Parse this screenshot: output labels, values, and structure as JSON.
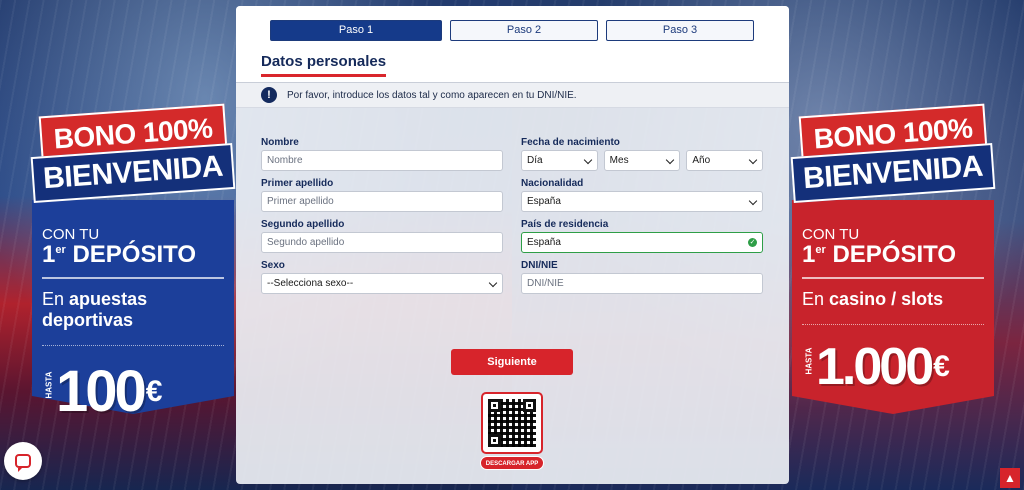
{
  "steps": [
    {
      "label": "Paso 1",
      "active": true
    },
    {
      "label": "Paso 2",
      "active": false
    },
    {
      "label": "Paso 3",
      "active": false
    }
  ],
  "section_title": "Datos personales",
  "notice": "Por favor, introduce los datos tal y como aparecen en tu DNI/NIE.",
  "form": {
    "nombre": {
      "label": "Nombre",
      "placeholder": "Nombre"
    },
    "primer_apellido": {
      "label": "Primer apellido",
      "placeholder": "Primer apellido"
    },
    "segundo_apellido": {
      "label": "Segundo apellido",
      "placeholder": "Segundo apellido"
    },
    "sexo": {
      "label": "Sexo",
      "value": "--Selecciona sexo--"
    },
    "fecha": {
      "label": "Fecha de nacimiento",
      "dia": "Día",
      "mes": "Mes",
      "anio": "Año"
    },
    "nacionalidad": {
      "label": "Nacionalidad",
      "value": "España"
    },
    "pais_residencia": {
      "label": "País de residencia",
      "value": "España"
    },
    "dni": {
      "label": "DNI/NIE",
      "placeholder": "DNI/NIE"
    }
  },
  "next_button": "Siguiente",
  "download_app": "DESCARGAR APP",
  "promo_left": {
    "bono": "BONO 100%",
    "bienvenida": "BIENVENIDA",
    "con_tu": "CON TU",
    "deposito_prefix": "1",
    "deposito_sup": "er",
    "deposito": "DEPÓSITO",
    "en": "En",
    "en_bold": "apuestas deportivas",
    "hasta": "HASTA",
    "amount": "100",
    "currency": "€"
  },
  "promo_right": {
    "bono": "BONO 100%",
    "bienvenida": "BIENVENIDA",
    "con_tu": "CON TU",
    "deposito_prefix": "1",
    "deposito_sup": "er",
    "deposito": "DEPÓSITO",
    "en": "En",
    "en_bold": "casino / slots",
    "hasta": "HASTA",
    "amount": "1.000",
    "currency": "€"
  },
  "colors": {
    "accent_red": "#d7242b",
    "navy": "#153a8a",
    "valid_green": "#2e9e47"
  },
  "icons": {
    "notice": "info-icon",
    "chat": "chat-icon",
    "scroll": "arrow-up-icon",
    "valid": "check-circle-icon",
    "qr": "qr-code-icon"
  }
}
